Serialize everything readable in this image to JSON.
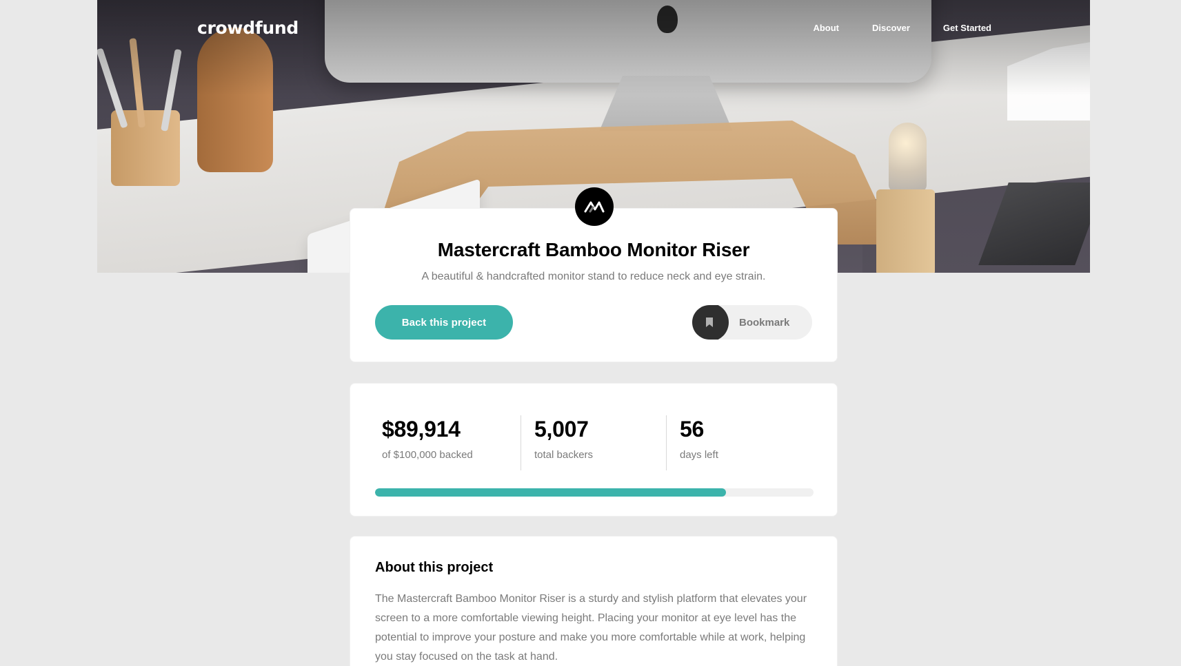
{
  "brand": {
    "logo": "crowdfund"
  },
  "nav": {
    "links": [
      "About",
      "Discover",
      "Get Started"
    ]
  },
  "project": {
    "title": "Mastercraft Bamboo Monitor Riser",
    "subtitle": "A beautiful & handcrafted monitor stand to reduce neck and eye strain.",
    "back_button": "Back this project",
    "bookmark_label": "Bookmark",
    "badge_icon": "mastercraft-logo-icon"
  },
  "stats": {
    "backed": {
      "value": "$89,914",
      "label": "of $100,000 backed"
    },
    "backers": {
      "value": "5,007",
      "label": "total backers"
    },
    "days": {
      "value": "56",
      "label": "days left"
    },
    "progress_percent": 80
  },
  "about": {
    "title": "About this project",
    "text": "The Mastercraft Bamboo Monitor Riser is a sturdy and stylish platform that elevates your screen to a more comfortable viewing height. Placing your monitor at eye level has the potential to improve your posture and make you more comfortable while at work, helping you stay focused on the task at hand."
  },
  "colors": {
    "accent": "#3cb3ab",
    "background": "#e9e9e9",
    "card": "#ffffff",
    "dark": "#2f2f2f"
  }
}
